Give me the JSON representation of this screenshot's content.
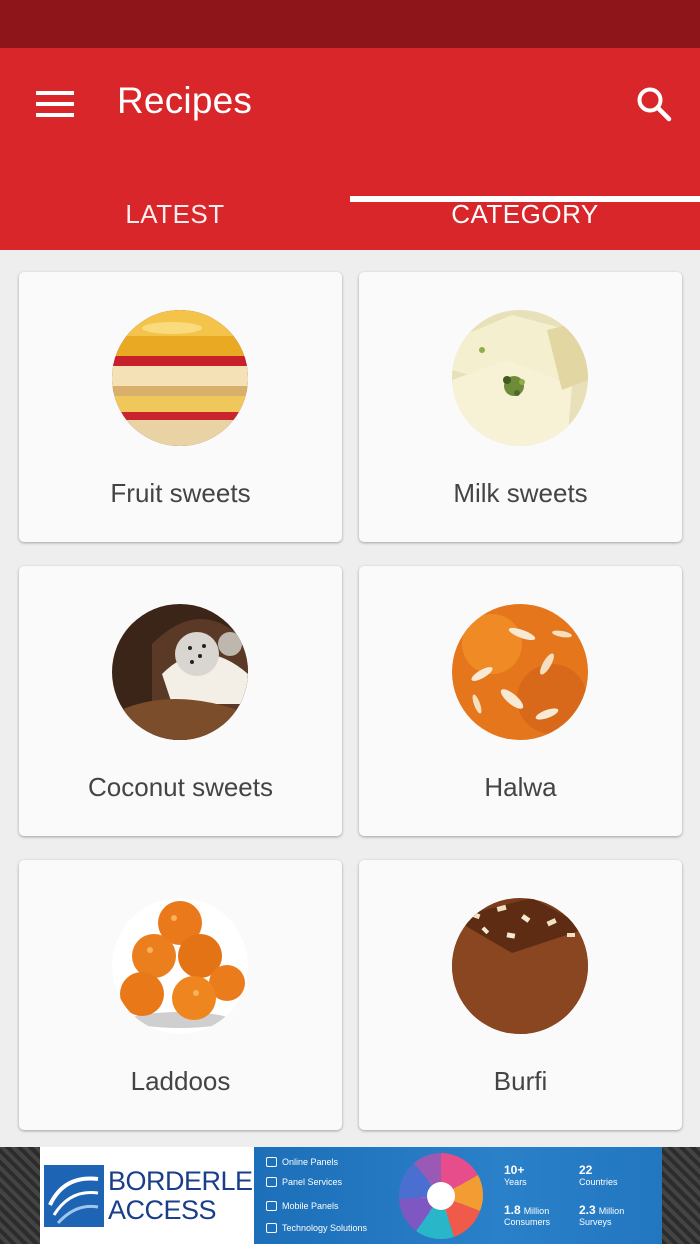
{
  "app": {
    "title": "Recipes",
    "colors": {
      "primary": "#d9262a",
      "primary_dark": "#8e1519",
      "indicator": "#ffffff"
    },
    "icons": {
      "menu": "hamburger-menu-icon",
      "search": "search-icon"
    }
  },
  "tabs": [
    {
      "label": "LATEST",
      "selected": false
    },
    {
      "label": "CATEGORY",
      "selected": true
    }
  ],
  "categories": [
    {
      "label": "Fruit sweets",
      "image": "fruit-sweets-photo"
    },
    {
      "label": "Milk sweets",
      "image": "milk-sweets-photo"
    },
    {
      "label": "Coconut sweets",
      "image": "coconut-sweets-photo"
    },
    {
      "label": "Halwa",
      "image": "halwa-photo"
    },
    {
      "label": "Laddoos",
      "image": "laddoos-photo"
    },
    {
      "label": "Burfi",
      "image": "burfi-photo"
    }
  ],
  "ad": {
    "brand_line1": "BORDERLESS",
    "brand_line2": "ACCESS",
    "services": [
      "Online Panels",
      "Panel Services",
      "Mobile Panels",
      "Technology Solutions"
    ],
    "stats": [
      {
        "value": "10+",
        "label": "Years"
      },
      {
        "value": "22",
        "label": "Countries"
      },
      {
        "value": "1.8",
        "unit": "Million",
        "label": "Consumers"
      },
      {
        "value": "2.3",
        "unit": "Million",
        "label": "Surveys"
      }
    ]
  }
}
